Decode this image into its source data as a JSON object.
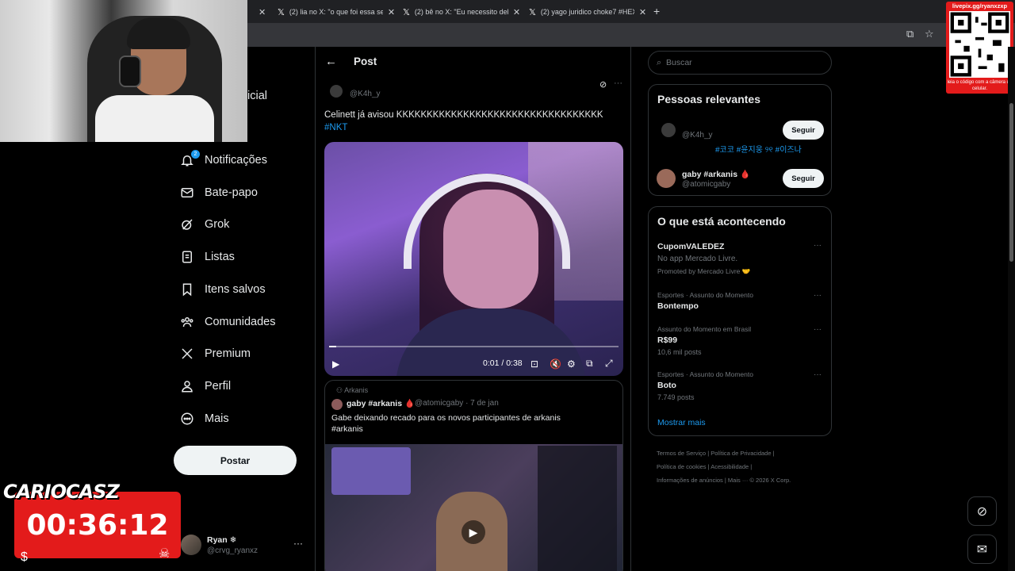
{
  "browser": {
    "tabs": [
      {
        "title": "(2) lia no X: \"o que foi essa seq"
      },
      {
        "title": "(2) bê no X: \"Eu necessito dela c"
      },
      {
        "title": "(2) yago juridico choke7 #HEXA"
      }
    ],
    "new_tab": "+"
  },
  "stream": {
    "streamer_tag": "CARIOCASZ",
    "timer": "00:36:12",
    "qr_top": "livepix.gg/ryanxzxp",
    "qr_bottom": "leia o código com a câmera do celular."
  },
  "nav": {
    "partial_label": "icial",
    "notifications_badge": "2",
    "items": [
      {
        "label": "Notificações",
        "icon": "bell-icon"
      },
      {
        "label": "Bate-papo",
        "icon": "mail-icon"
      },
      {
        "label": "Grok",
        "icon": "grok-icon"
      },
      {
        "label": "Listas",
        "icon": "list-icon"
      },
      {
        "label": "Itens salvos",
        "icon": "bookmark-icon"
      },
      {
        "label": "Comunidades",
        "icon": "communities-icon"
      },
      {
        "label": "Premium",
        "icon": "x-logo-icon"
      },
      {
        "label": "Perfil",
        "icon": "person-icon"
      },
      {
        "label": "Mais",
        "icon": "more-circle-icon"
      }
    ],
    "post_button": "Postar",
    "account": {
      "name": "Ryan ❄",
      "handle": "@crvg_ryanxz",
      "more": "···"
    }
  },
  "main": {
    "title": "Post",
    "author_handle": "@K4h_y",
    "tweet_text": "Celinett já avisou KKKKKKKKKKKKKKKKKKKKKKKKKKKKKKKKKK",
    "tweet_hashtag": "#NKT",
    "video": {
      "time": "0:01 / 0:38",
      "progress": 0.026
    },
    "quote": {
      "community": "Arkanis",
      "name": "gaby #arkanis 🩸",
      "meta": "@atomicgaby · 7 de jan",
      "text_line1": "Gabe deixando recado para os novos participantes de arkanis",
      "text_line2": "#arkanis"
    }
  },
  "sidebar": {
    "search_placeholder": "Buscar",
    "relevant_title": "Pessoas relevantes",
    "people": [
      {
        "name": "",
        "handle": "@K4h_y",
        "bio": "#코코 #윤지웅 ୨୧ #이즈나",
        "follow": "Seguir"
      },
      {
        "name": "gaby #arkanis 🩸",
        "handle": "@atomicgaby",
        "bio": "",
        "follow": "Seguir"
      }
    ],
    "trends_title": "O que está acontecendo",
    "trends": [
      {
        "category": "",
        "name": "CupomVALEDEZ",
        "sub": "No app Mercado Livre.",
        "promo": "Promoted by Mercado Livre 🤝"
      },
      {
        "category": "Esportes · Assunto do Momento",
        "name": "Bontempo",
        "sub": "",
        "promo": ""
      },
      {
        "category": "Assunto do Momento em Brasil",
        "name": "R$99",
        "sub": "10,6 mil posts",
        "promo": ""
      },
      {
        "category": "Esportes · Assunto do Momento",
        "name": "Boto",
        "sub": "7.749 posts",
        "promo": ""
      }
    ],
    "show_more": "Mostrar mais",
    "footer": {
      "line1": "Termos de Serviço  |  Política de Privacidade  |",
      "line2": "Política de cookies  |  Acessibilidade  |",
      "line3": "Informações de anúncios  |  Mais ···  © 2026 X Corp."
    }
  }
}
